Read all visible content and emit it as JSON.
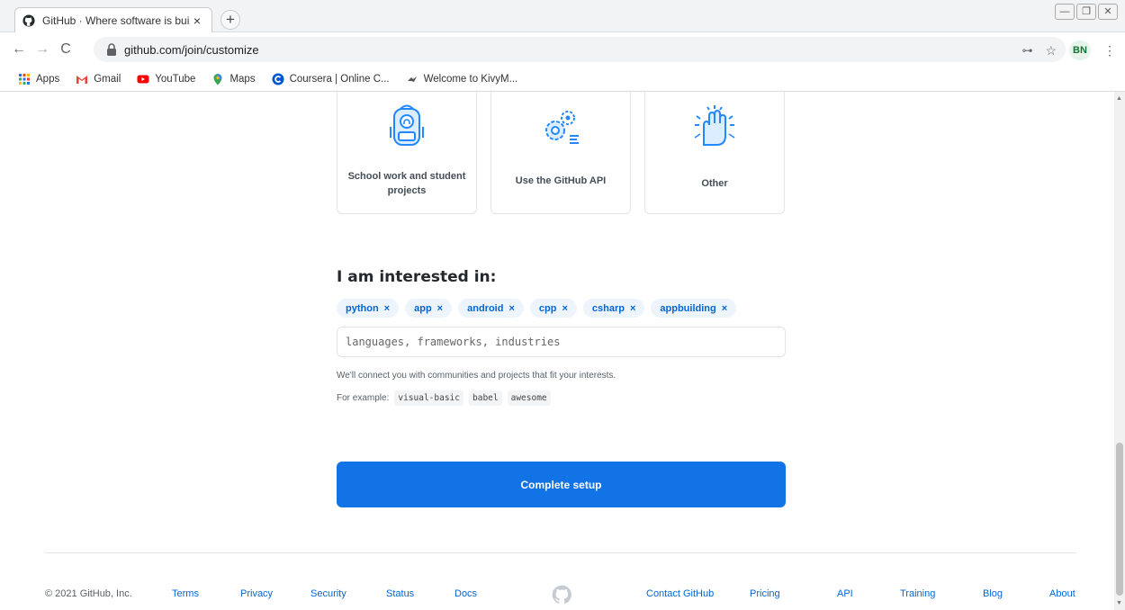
{
  "browser": {
    "tab_title": "GitHub · Where software is built",
    "tab_close": "×",
    "new_tab": "+",
    "url": "github.com/join/customize",
    "profile": "BN",
    "window_controls": [
      "—",
      "❐",
      "✕"
    ]
  },
  "bookmarks": [
    {
      "label": "Apps",
      "icon": "apps-grid-icon"
    },
    {
      "label": "Gmail",
      "icon": "gmail-icon"
    },
    {
      "label": "YouTube",
      "icon": "youtube-icon"
    },
    {
      "label": "Maps",
      "icon": "maps-icon"
    },
    {
      "label": "Coursera | Online C...",
      "icon": "coursera-icon"
    },
    {
      "label": "Welcome to KivyM...",
      "icon": "kivy-icon"
    }
  ],
  "cards": [
    {
      "label": "School work and student projects",
      "icon": "backpack-icon"
    },
    {
      "label": "Use the GitHub API",
      "icon": "gears-icon"
    },
    {
      "label": "Other",
      "icon": "high-five-icon"
    }
  ],
  "interests": {
    "title": "I am interested in:",
    "chips": [
      "python",
      "app",
      "android",
      "cpp",
      "csharp",
      "appbuilding"
    ],
    "chip_remove": "×",
    "placeholder": "languages, frameworks, industries",
    "hint": "We'll connect you with communities and projects that fit your interests.",
    "example_label": "For example:",
    "examples": [
      "visual-basic",
      "babel",
      "awesome"
    ]
  },
  "complete_button": "Complete setup",
  "footer": {
    "copyright": "© 2021 GitHub, Inc.",
    "links_left": [
      "Terms",
      "Privacy",
      "Security",
      "Status",
      "Docs"
    ],
    "links_right": [
      "Contact GitHub",
      "Pricing",
      "API",
      "Training",
      "Blog",
      "About"
    ]
  },
  "colors": {
    "primary_button": "#1173e6",
    "chip_bg": "#eef4fc",
    "link": "#0366d6"
  }
}
